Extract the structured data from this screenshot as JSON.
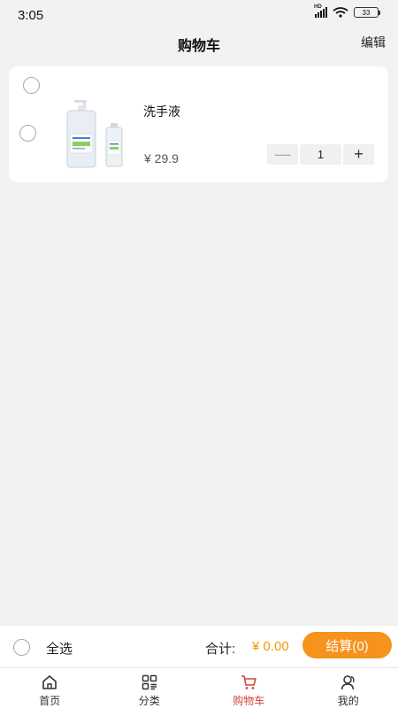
{
  "status_bar": {
    "time": "3:05",
    "network": "HD",
    "battery": "33"
  },
  "nav": {
    "title": "购物车",
    "edit_label": "编辑"
  },
  "cart": {
    "items": [
      {
        "name": "洗手液",
        "price": "¥ 29.9",
        "quantity": "1",
        "minus_symbol": "—",
        "plus_symbol": "+",
        "image_icon": "hand-sanitizer-image"
      }
    ]
  },
  "checkout": {
    "select_all_label": "全选",
    "total_label": "合计:",
    "total_amount": "¥ 0.00",
    "checkout_button": "结算(0)",
    "accent_color": "#f6931c"
  },
  "tabs": [
    {
      "label": "首页",
      "icon": "home-icon",
      "active": false
    },
    {
      "label": "分类",
      "icon": "category-icon",
      "active": false
    },
    {
      "label": "购物车",
      "icon": "cart-icon",
      "active": true
    },
    {
      "label": "我的",
      "icon": "user-icon",
      "active": false
    }
  ],
  "active_color": "#d2433a"
}
